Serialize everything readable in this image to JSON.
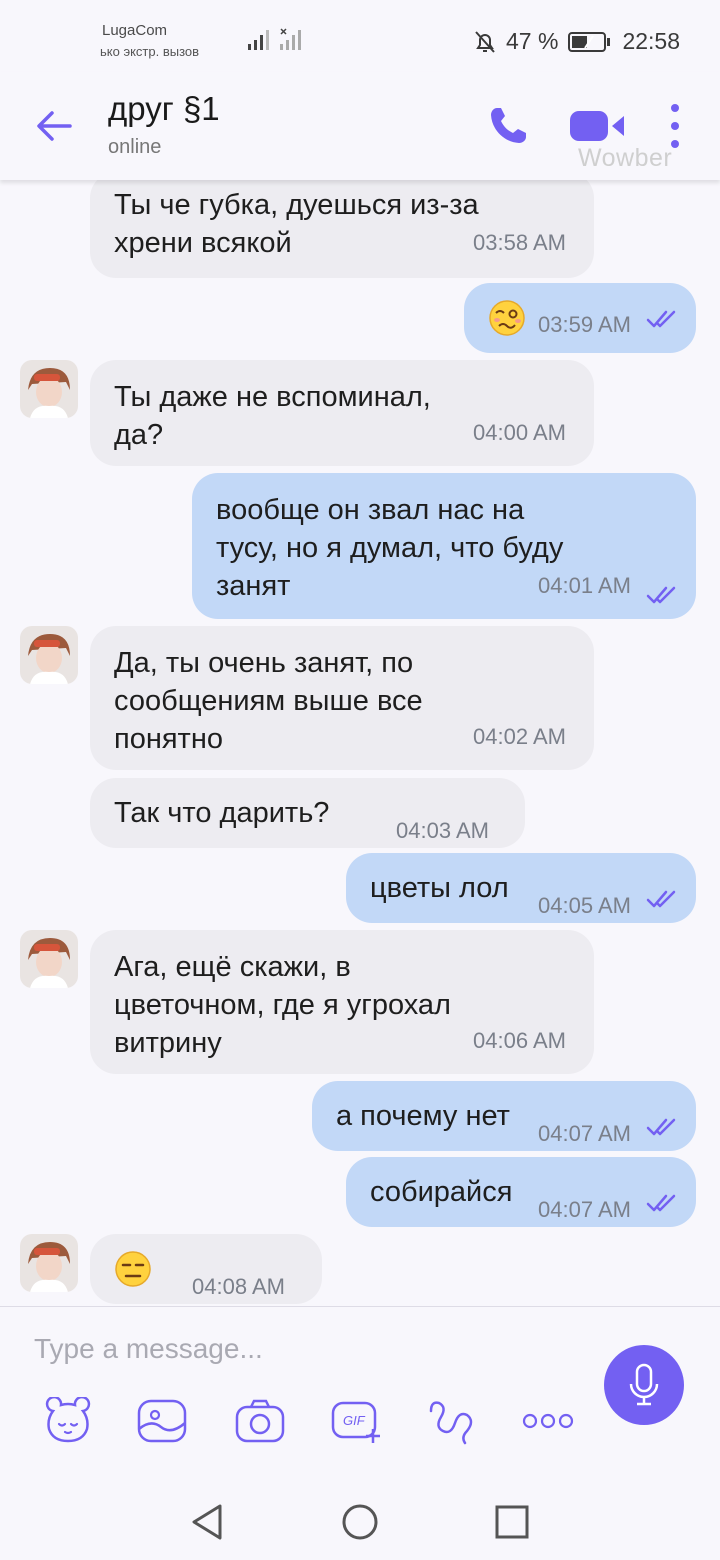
{
  "status_bar": {
    "carrier": "LugaCom",
    "carrier_sub": "ько экстр. вызов",
    "battery": "47 %",
    "time": "22:58"
  },
  "header": {
    "contact_name": "друг §1",
    "status": "online",
    "watermark": "Wowber",
    "icons": [
      "back-arrow-icon",
      "phone-icon",
      "video-camera-icon",
      "more-vertical-icon"
    ],
    "accent_color": "#7360f2"
  },
  "messages": [
    {
      "direction": "in",
      "lines": [
        "Ты че губка, дуешься из-за",
        "хрени всякой"
      ],
      "time": "03:58 AM"
    },
    {
      "direction": "out",
      "emoji": "woozy-face",
      "time": "03:59 AM",
      "read": true
    },
    {
      "direction": "in",
      "lines": [
        "Ты даже не вспоминал,",
        "да?"
      ],
      "time": "04:00 AM"
    },
    {
      "direction": "out",
      "lines": [
        "вообще он звал нас на",
        "тусу, но я думал, что буду",
        "занят"
      ],
      "time": "04:01 AM",
      "read": true
    },
    {
      "direction": "in",
      "lines": [
        "Да, ты очень занят, по",
        "сообщениям выше все",
        "понятно"
      ],
      "time": "04:02 AM"
    },
    {
      "direction": "in",
      "lines": [
        "Так что дарить?"
      ],
      "time": "04:03 AM"
    },
    {
      "direction": "out",
      "lines": [
        "цветы лол"
      ],
      "time": "04:05 AM",
      "read": true
    },
    {
      "direction": "in",
      "lines": [
        "Ага, ещё скажи, в",
        "цветочном, где я угрохал",
        "витрину"
      ],
      "time": "04:06 AM"
    },
    {
      "direction": "out",
      "lines": [
        "а почему нет"
      ],
      "time": "04:07 AM",
      "read": true
    },
    {
      "direction": "out",
      "lines": [
        "собирайся"
      ],
      "time": "04:07 AM",
      "read": true
    },
    {
      "direction": "in",
      "emoji": "expressionless-face",
      "time": "04:08 AM"
    }
  ],
  "composer": {
    "placeholder": "Type a message...",
    "toolbar": [
      "sticker-icon",
      "gallery-icon",
      "camera-icon",
      "gif-icon",
      "doodle-icon",
      "more-options-icon"
    ],
    "gif_label": "GIF"
  },
  "colors": {
    "incoming_bubble": "#edecf1",
    "outgoing_bubble": "#c2d8f7",
    "read_ticks": "#7360f2"
  }
}
